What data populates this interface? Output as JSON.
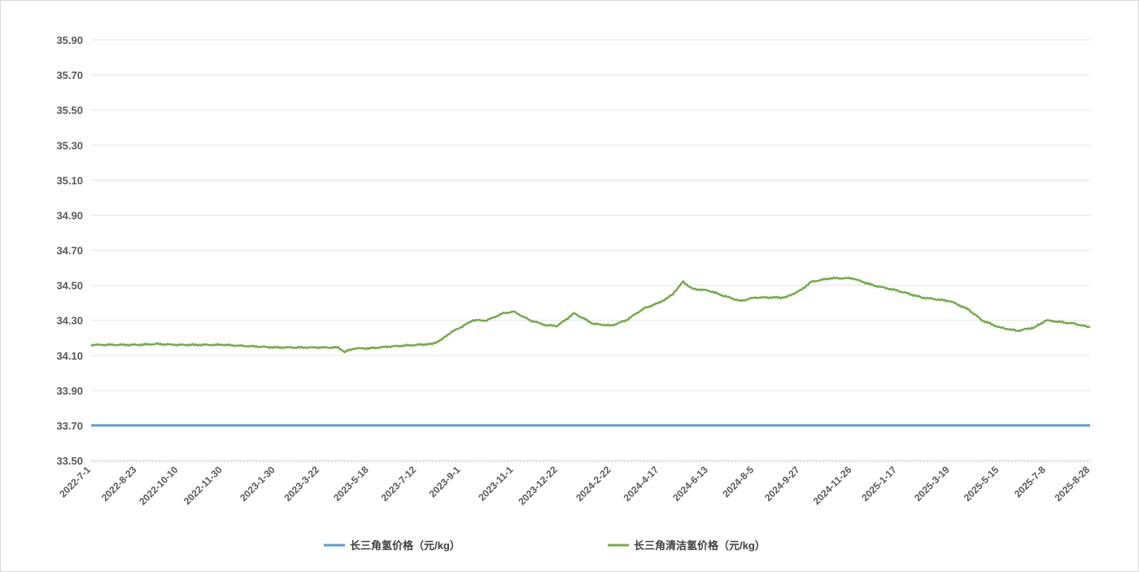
{
  "chart_data": {
    "type": "line",
    "title": "",
    "xlabel": "",
    "ylabel": "",
    "ylim": [
      33.5,
      35.9
    ],
    "y_ticks": [
      "35.90",
      "35.70",
      "35.50",
      "35.30",
      "35.10",
      "34.90",
      "34.70",
      "34.50",
      "34.30",
      "34.10",
      "33.90",
      "33.70",
      "33.50"
    ],
    "x_ticks": [
      "2022-7-1",
      "2022-8-23",
      "2022-10-10",
      "2022-11-30",
      "2023-1-30",
      "2023-3-22",
      "2023-5-18",
      "2023-7-12",
      "2023-9-1",
      "2023-11-1",
      "2023-12-22",
      "2024-2-22",
      "2024-4-17",
      "2024-6-13",
      "2024-8-5",
      "2024-9-27",
      "2024-11-26",
      "2025-1-17",
      "2025-3-19",
      "2025-5-15",
      "2025-7-8",
      "2025-8-28"
    ],
    "grid": true,
    "legend_position": "bottom",
    "series": [
      {
        "name": "长三角氢价格（元/kg）",
        "color": "#5b9bd5",
        "x": [
          "2022-7-1",
          "2025-8-28"
        ],
        "values": [
          33.7,
          33.7
        ]
      },
      {
        "name": "长三角清洁氢价格（元/kg）",
        "color": "#70ad47",
        "x": [
          "2022-7-1",
          "2022-7-20",
          "2022-8-23",
          "2022-9-15",
          "2022-10-10",
          "2022-11-1",
          "2022-11-30",
          "2022-12-20",
          "2023-1-10",
          "2023-1-30",
          "2023-3-1",
          "2023-3-22",
          "2023-4-12",
          "2023-4-20",
          "2023-5-1",
          "2023-5-18",
          "2023-6-10",
          "2023-7-12",
          "2023-7-30",
          "2023-8-10",
          "2023-8-20",
          "2023-9-1",
          "2023-9-15",
          "2023-10-1",
          "2023-10-20",
          "2023-11-1",
          "2023-11-20",
          "2023-12-10",
          "2023-12-22",
          "2024-1-10",
          "2024-2-1",
          "2024-2-22",
          "2024-3-10",
          "2024-3-25",
          "2024-4-1",
          "2024-4-17",
          "2024-5-1",
          "2024-5-15",
          "2024-5-25",
          "2024-6-13",
          "2024-7-1",
          "2024-7-20",
          "2024-8-5",
          "2024-8-25",
          "2024-9-10",
          "2024-9-27",
          "2024-10-10",
          "2024-11-1",
          "2024-11-26",
          "2024-12-20",
          "2025-1-17",
          "2025-2-15",
          "2025-3-19",
          "2025-4-10",
          "2025-4-25",
          "2025-5-15",
          "2025-6-5",
          "2025-6-25",
          "2025-7-8",
          "2025-7-25",
          "2025-8-10",
          "2025-8-28"
        ],
        "values": [
          34.16,
          34.16,
          34.16,
          34.165,
          34.16,
          34.16,
          34.16,
          34.155,
          34.15,
          34.145,
          34.145,
          34.145,
          34.145,
          34.12,
          34.14,
          34.14,
          34.15,
          34.16,
          34.165,
          34.19,
          34.23,
          34.26,
          34.3,
          34.3,
          34.34,
          34.35,
          34.3,
          34.27,
          34.27,
          34.34,
          34.28,
          34.27,
          34.3,
          34.35,
          34.37,
          34.4,
          34.44,
          34.52,
          34.48,
          34.47,
          34.44,
          34.41,
          34.43,
          34.43,
          34.43,
          34.47,
          34.52,
          34.54,
          34.54,
          34.5,
          34.47,
          34.43,
          34.41,
          34.36,
          34.3,
          34.26,
          34.24,
          34.26,
          34.3,
          34.29,
          34.28,
          34.26
        ]
      }
    ]
  }
}
